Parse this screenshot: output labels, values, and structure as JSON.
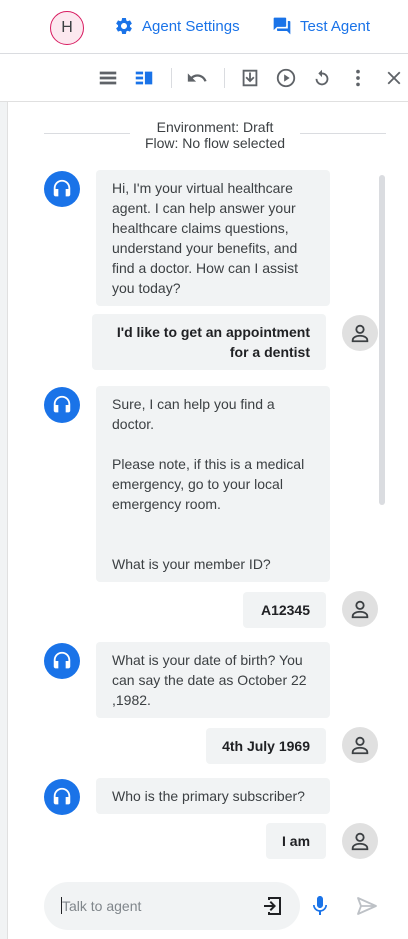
{
  "header": {
    "avatar_letter": "H",
    "agent_settings_label": "Agent Settings",
    "test_agent_label": "Test Agent"
  },
  "toolbar": {
    "icons": [
      "view-list-icon",
      "view-split-icon",
      "undo-icon",
      "download-icon",
      "play-icon",
      "reset-icon",
      "more-vert-icon",
      "close-icon"
    ]
  },
  "environment": {
    "line1": "Environment: Draft",
    "line2": "Flow: No flow selected"
  },
  "messages": [
    {
      "role": "agent",
      "text": "Hi, I'm your virtual healthcare agent. I can help answer your healthcare claims questions, understand your benefits, and find a doctor. How can I assist you today?"
    },
    {
      "role": "user",
      "text": "I'd like to get an appointment for a dentist"
    },
    {
      "role": "agent",
      "text": "Sure, I can help you find a doctor.\n\nPlease note, if this is a medical emergency, go to your local emergency room.\n\n\nWhat is your member ID?"
    },
    {
      "role": "user",
      "text": "A12345"
    },
    {
      "role": "agent",
      "text": "What is your date of birth? You can say the date as October 22 ,1982."
    },
    {
      "role": "user",
      "text": "4th July 1969"
    },
    {
      "role": "agent",
      "text": "Who is the primary subscriber?"
    },
    {
      "role": "user",
      "text": "I am"
    }
  ],
  "input": {
    "placeholder": "Talk to agent",
    "value": ""
  },
  "colors": {
    "accent": "#1a73e8",
    "bubble": "#f1f3f4",
    "avatar_border": "#d81b60"
  }
}
